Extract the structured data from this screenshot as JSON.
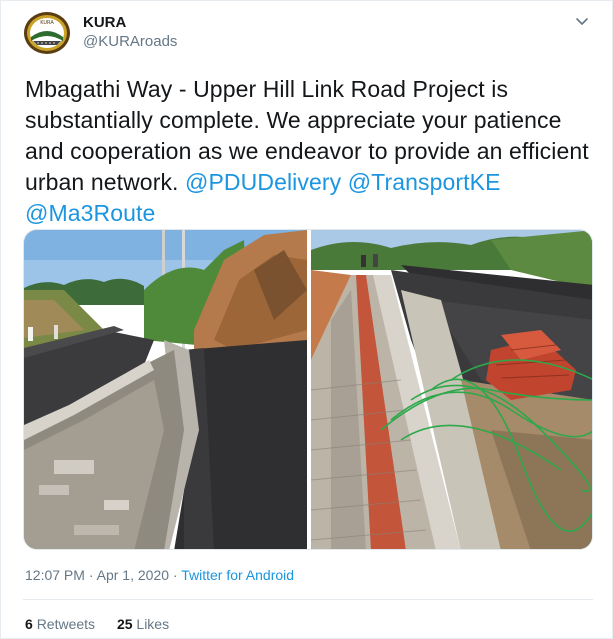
{
  "author": {
    "display_name": "KURA",
    "handle": "@KURAroads",
    "avatar_icon": "kura-logo-icon",
    "avatar_text": "KURA"
  },
  "menu": {
    "icon": "chevron-down-icon"
  },
  "tweet": {
    "text_line1": "Mbagathi Way - Upper Hill Link Road Project is",
    "text_line2": "substantially complete. We appreciate your patience",
    "text_line3": "and cooperation as we endeavor to provide an efficient",
    "text_line4": "urban network.",
    "mention1": "@PDUDelivery",
    "mention2": "@TransportKE",
    "mention3": "@Ma3Route"
  },
  "media": {
    "photos": [
      {
        "name": "new asphalt road curving past a rocky hillside"
      },
      {
        "name": "red and grey paver walkway beside new road with bricks and green cables"
      }
    ]
  },
  "meta": {
    "time": "12:07 PM",
    "sep1": "·",
    "date": "Apr 1, 2020",
    "sep2": "·",
    "source": "Twitter for Android"
  },
  "stats": {
    "retweets_count": "6",
    "retweets_label": "Retweets",
    "likes_count": "25",
    "likes_label": "Likes"
  },
  "colors": {
    "link": "#1b95e0",
    "secondary_text": "#657786",
    "primary_text": "#14171a"
  }
}
